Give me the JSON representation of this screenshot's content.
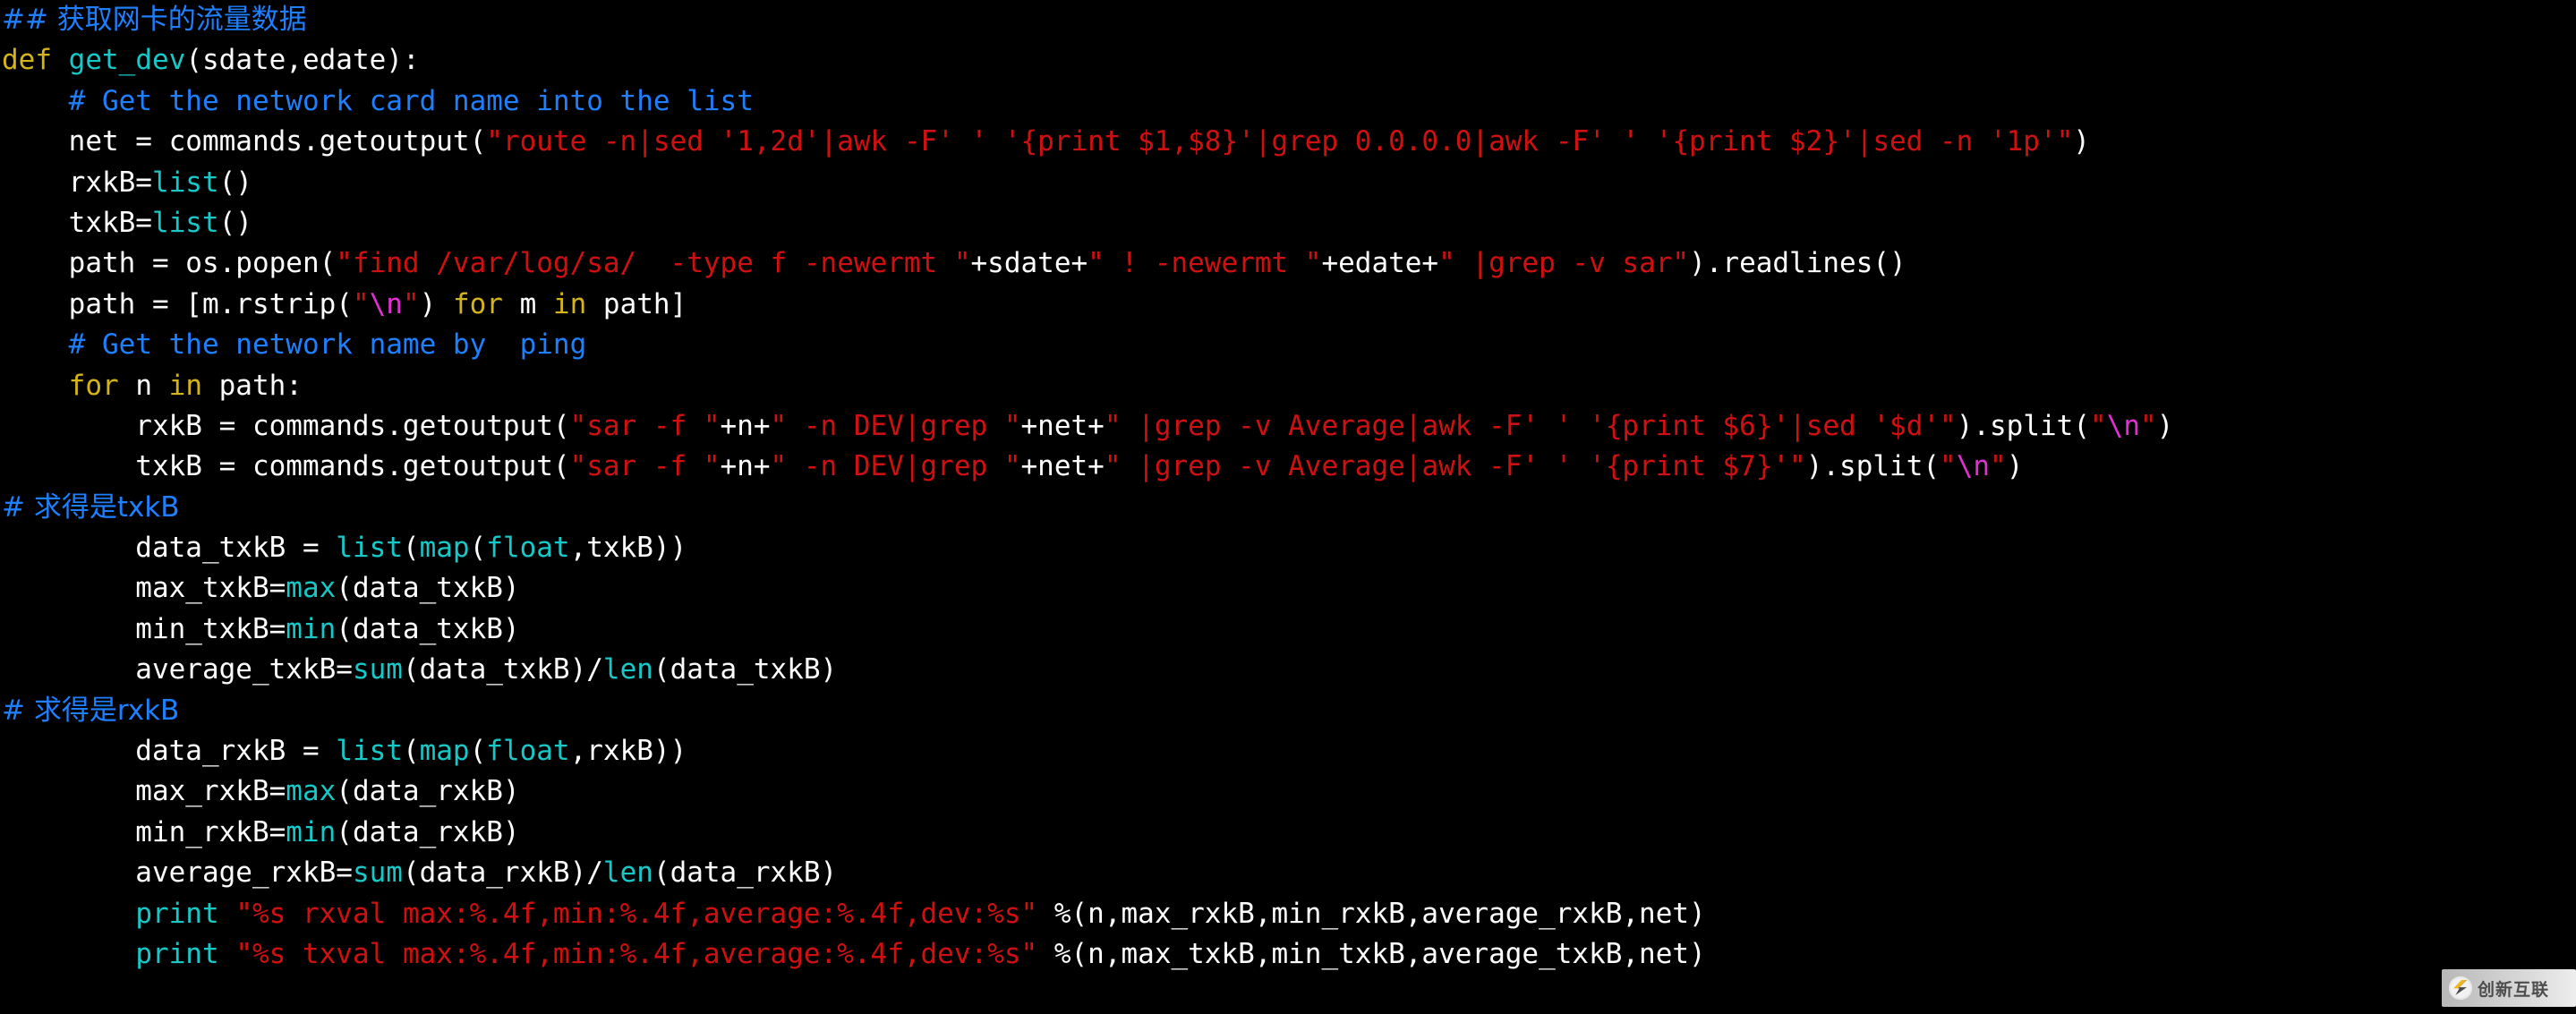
{
  "editor": {
    "background": "#000000",
    "default_text_color": "#ffffff",
    "language": "python",
    "colors": {
      "comment": "#1e7fff",
      "keyword": "#d4b419",
      "function": "#17c8c8",
      "builtin": "#17c8c8",
      "string": "#d01010",
      "escape": "#e030d0",
      "plain": "#ffffff"
    }
  },
  "code": {
    "lines": [
      {
        "n": 1,
        "text": "## 获取网卡的流量数据",
        "tokens": [
          {
            "t": "## 获取网卡的流量数据",
            "c": "cmt-cn"
          }
        ]
      },
      {
        "n": 2,
        "text": "def get_dev(sdate,edate):",
        "tokens": [
          {
            "t": "def",
            "c": "kw"
          },
          {
            "t": " ",
            "c": "plain"
          },
          {
            "t": "get_dev",
            "c": "fn"
          },
          {
            "t": "(sdate,edate):",
            "c": "plain"
          }
        ]
      },
      {
        "n": 3,
        "text": "    # Get the network card name into the list",
        "tokens": [
          {
            "t": "    ",
            "c": "plain"
          },
          {
            "t": "# Get the network card name into the list",
            "c": "cmt"
          }
        ]
      },
      {
        "n": 4,
        "text": "    net = commands.getoutput(\"route -n|sed '1,2d'|awk -F' ' '{print $1,$8}'|grep 0.0.0.0|awk -F' ' '{print $2}'|sed -n '1p'\")",
        "tokens": [
          {
            "t": "    net = commands.getoutput(",
            "c": "plain"
          },
          {
            "t": "\"route -n|sed '1,2d'|awk -F' ' '{print $1,$8}'|grep 0.0.0.0|awk -F' ' '{print $2}'|sed -n '1p'\"",
            "c": "str"
          },
          {
            "t": ")",
            "c": "plain"
          }
        ]
      },
      {
        "n": 5,
        "text": "    rxkB=list()",
        "tokens": [
          {
            "t": "    rxkB=",
            "c": "plain"
          },
          {
            "t": "list",
            "c": "builtin"
          },
          {
            "t": "()",
            "c": "plain"
          }
        ]
      },
      {
        "n": 6,
        "text": "    txkB=list()",
        "tokens": [
          {
            "t": "    txkB=",
            "c": "plain"
          },
          {
            "t": "list",
            "c": "builtin"
          },
          {
            "t": "()",
            "c": "plain"
          }
        ]
      },
      {
        "n": 7,
        "text": "    path = os.popen(\"find /var/log/sa/  -type f -newermt \"+sdate+\" ! -newermt \"+edate+\" |grep -v sar\").readlines()",
        "tokens": [
          {
            "t": "    path = os.popen(",
            "c": "plain"
          },
          {
            "t": "\"find /var/log/sa/  -type f -newermt \"",
            "c": "str"
          },
          {
            "t": "+sdate+",
            "c": "plain"
          },
          {
            "t": "\" ! -newermt \"",
            "c": "str"
          },
          {
            "t": "+edate+",
            "c": "plain"
          },
          {
            "t": "\" |grep -v sar\"",
            "c": "str"
          },
          {
            "t": ").readlines()",
            "c": "plain"
          }
        ]
      },
      {
        "n": 8,
        "text": "    path = [m.rstrip(\"\\n\") for m in path]",
        "tokens": [
          {
            "t": "    path = [m.rstrip(",
            "c": "plain"
          },
          {
            "t": "\"",
            "c": "str"
          },
          {
            "t": "\\n",
            "c": "esc"
          },
          {
            "t": "\"",
            "c": "str"
          },
          {
            "t": ") ",
            "c": "plain"
          },
          {
            "t": "for",
            "c": "kw"
          },
          {
            "t": " m ",
            "c": "plain"
          },
          {
            "t": "in",
            "c": "kw"
          },
          {
            "t": " path]",
            "c": "plain"
          }
        ]
      },
      {
        "n": 9,
        "text": "    # Get the network name by  ping",
        "tokens": [
          {
            "t": "    ",
            "c": "plain"
          },
          {
            "t": "# Get the network name by  ping",
            "c": "cmt"
          }
        ]
      },
      {
        "n": 10,
        "text": "    for n in path:",
        "tokens": [
          {
            "t": "    ",
            "c": "plain"
          },
          {
            "t": "for",
            "c": "kw"
          },
          {
            "t": " n ",
            "c": "plain"
          },
          {
            "t": "in",
            "c": "kw"
          },
          {
            "t": " path:",
            "c": "plain"
          }
        ]
      },
      {
        "n": 11,
        "text": "        rxkB = commands.getoutput(\"sar -f \"+n+\" -n DEV|grep \"+net+\" |grep -v Average|awk -F' ' '{print $6}'|sed '$d'\").split(\"\\n\")",
        "tokens": [
          {
            "t": "        rxkB = commands.getoutput(",
            "c": "plain"
          },
          {
            "t": "\"sar -f \"",
            "c": "str"
          },
          {
            "t": "+n+",
            "c": "plain"
          },
          {
            "t": "\" -n DEV|grep \"",
            "c": "str"
          },
          {
            "t": "+net+",
            "c": "plain"
          },
          {
            "t": "\" |grep -v Average|awk -F' ' '{print $6}'|sed '$d'\"",
            "c": "str"
          },
          {
            "t": ").split(",
            "c": "plain"
          },
          {
            "t": "\"",
            "c": "str"
          },
          {
            "t": "\\n",
            "c": "esc"
          },
          {
            "t": "\"",
            "c": "str"
          },
          {
            "t": ")",
            "c": "plain"
          }
        ]
      },
      {
        "n": 12,
        "text": "        txkB = commands.getoutput(\"sar -f \"+n+\" -n DEV|grep \"+net+\" |grep -v Average|awk -F' ' '{print $7}'\").split(\"\\n\")",
        "tokens": [
          {
            "t": "        txkB = commands.getoutput(",
            "c": "plain"
          },
          {
            "t": "\"sar -f \"",
            "c": "str"
          },
          {
            "t": "+n+",
            "c": "plain"
          },
          {
            "t": "\" -n DEV|grep \"",
            "c": "str"
          },
          {
            "t": "+net+",
            "c": "plain"
          },
          {
            "t": "\" |grep -v Average|awk -F' ' '{print $7}'\"",
            "c": "str"
          },
          {
            "t": ").split(",
            "c": "plain"
          },
          {
            "t": "\"",
            "c": "str"
          },
          {
            "t": "\\n",
            "c": "esc"
          },
          {
            "t": "\"",
            "c": "str"
          },
          {
            "t": ")",
            "c": "plain"
          }
        ]
      },
      {
        "n": 13,
        "text": "# 求得是txkB",
        "tokens": [
          {
            "t": "# 求得是txkB",
            "c": "cmt-cn"
          }
        ]
      },
      {
        "n": 14,
        "text": "        data_txkB = list(map(float,txkB))",
        "tokens": [
          {
            "t": "        data_txkB = ",
            "c": "plain"
          },
          {
            "t": "list",
            "c": "builtin"
          },
          {
            "t": "(",
            "c": "plain"
          },
          {
            "t": "map",
            "c": "builtin"
          },
          {
            "t": "(",
            "c": "plain"
          },
          {
            "t": "float",
            "c": "builtin"
          },
          {
            "t": ",txkB))",
            "c": "plain"
          }
        ]
      },
      {
        "n": 15,
        "text": "        max_txkB=max(data_txkB)",
        "tokens": [
          {
            "t": "        max_txkB=",
            "c": "plain"
          },
          {
            "t": "max",
            "c": "builtin"
          },
          {
            "t": "(data_txkB)",
            "c": "plain"
          }
        ]
      },
      {
        "n": 16,
        "text": "        min_txkB=min(data_txkB)",
        "tokens": [
          {
            "t": "        min_txkB=",
            "c": "plain"
          },
          {
            "t": "min",
            "c": "builtin"
          },
          {
            "t": "(data_txkB)",
            "c": "plain"
          }
        ]
      },
      {
        "n": 17,
        "text": "        average_txkB=sum(data_txkB)/len(data_txkB)",
        "tokens": [
          {
            "t": "        average_txkB=",
            "c": "plain"
          },
          {
            "t": "sum",
            "c": "builtin"
          },
          {
            "t": "(data_txkB)/",
            "c": "plain"
          },
          {
            "t": "len",
            "c": "builtin"
          },
          {
            "t": "(data_txkB)",
            "c": "plain"
          }
        ]
      },
      {
        "n": 18,
        "text": "# 求得是rxkB",
        "tokens": [
          {
            "t": "# 求得是rxkB",
            "c": "cmt-cn"
          }
        ]
      },
      {
        "n": 19,
        "text": "        data_rxkB = list(map(float,rxkB))",
        "tokens": [
          {
            "t": "        data_rxkB = ",
            "c": "plain"
          },
          {
            "t": "list",
            "c": "builtin"
          },
          {
            "t": "(",
            "c": "plain"
          },
          {
            "t": "map",
            "c": "builtin"
          },
          {
            "t": "(",
            "c": "plain"
          },
          {
            "t": "float",
            "c": "builtin"
          },
          {
            "t": ",rxkB))",
            "c": "plain"
          }
        ]
      },
      {
        "n": 20,
        "text": "        max_rxkB=max(data_rxkB)",
        "tokens": [
          {
            "t": "        max_rxkB=",
            "c": "plain"
          },
          {
            "t": "max",
            "c": "builtin"
          },
          {
            "t": "(data_rxkB)",
            "c": "plain"
          }
        ]
      },
      {
        "n": 21,
        "text": "        min_rxkB=min(data_rxkB)",
        "tokens": [
          {
            "t": "        min_rxkB=",
            "c": "plain"
          },
          {
            "t": "min",
            "c": "builtin"
          },
          {
            "t": "(data_rxkB)",
            "c": "plain"
          }
        ]
      },
      {
        "n": 22,
        "text": "        average_rxkB=sum(data_rxkB)/len(data_rxkB)",
        "tokens": [
          {
            "t": "        average_rxkB=",
            "c": "plain"
          },
          {
            "t": "sum",
            "c": "builtin"
          },
          {
            "t": "(data_rxkB)/",
            "c": "plain"
          },
          {
            "t": "len",
            "c": "builtin"
          },
          {
            "t": "(data_rxkB)",
            "c": "plain"
          }
        ]
      },
      {
        "n": 23,
        "text": "        print \"%s rxval max:%.4f,min:%.4f,average:%.4f,dev:%s\" %(n,max_rxkB,min_rxkB,average_rxkB,net)",
        "tokens": [
          {
            "t": "        ",
            "c": "plain"
          },
          {
            "t": "print",
            "c": "builtin"
          },
          {
            "t": " ",
            "c": "plain"
          },
          {
            "t": "\"%s rxval max:%.4f,min:%.4f,average:%.4f,dev:%s\"",
            "c": "str"
          },
          {
            "t": " %(n,max_rxkB,min_rxkB,average_rxkB,net)",
            "c": "plain"
          }
        ]
      },
      {
        "n": 24,
        "text": "        print \"%s txval max:%.4f,min:%.4f,average:%.4f,dev:%s\" %(n,max_txkB,min_txkB,average_txkB,net)",
        "tokens": [
          {
            "t": "        ",
            "c": "plain"
          },
          {
            "t": "print",
            "c": "builtin"
          },
          {
            "t": " ",
            "c": "plain"
          },
          {
            "t": "\"%s txval max:%.4f,min:%.4f,average:%.4f,dev:%s\"",
            "c": "str"
          },
          {
            "t": " %(n,max_txkB,min_txkB,average_txkB,net)",
            "c": "plain"
          }
        ]
      }
    ]
  },
  "watermark": {
    "text": "创新互联",
    "logo_icon": "lightning-circle-icon"
  }
}
